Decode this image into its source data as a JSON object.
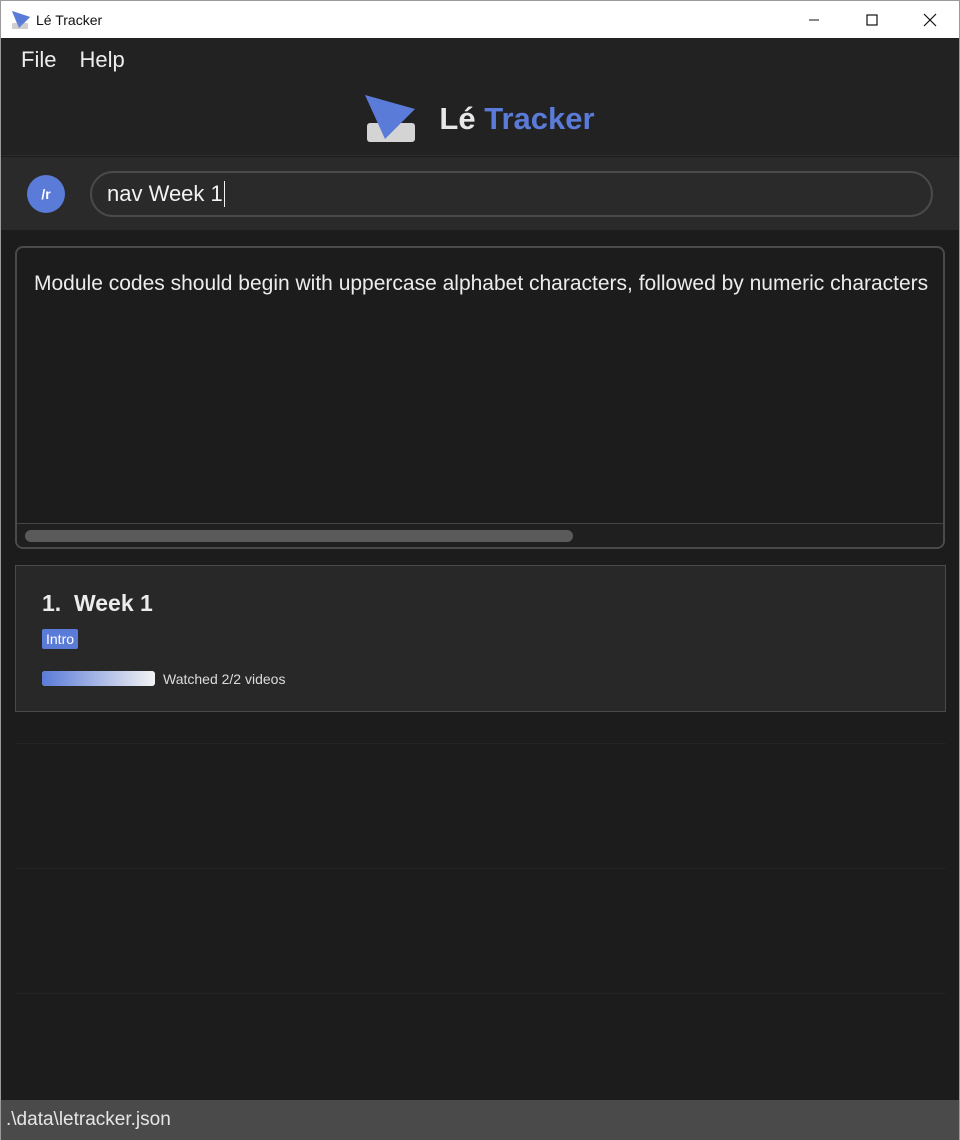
{
  "window": {
    "title": "Lé Tracker",
    "controls": [
      "minimize-icon",
      "maximize-icon",
      "close-icon"
    ]
  },
  "menu": {
    "file": "File",
    "help": "Help"
  },
  "brand": {
    "name_part1": "Lé",
    "name_part2": "Tracker",
    "accent_color": "#5b7bd8"
  },
  "command": {
    "badge": "/r",
    "value": "nav Week 1"
  },
  "result": {
    "message": "Module codes should begin with uppercase alphabet characters, followed by numeric characters"
  },
  "list": {
    "items": [
      {
        "index": "1.",
        "title": "Week 1",
        "tag": "Intro",
        "progress_fraction": 1.0,
        "progress_text": "Watched 2/2 videos"
      }
    ]
  },
  "status": {
    "path": ".\\data\\letracker.json"
  }
}
